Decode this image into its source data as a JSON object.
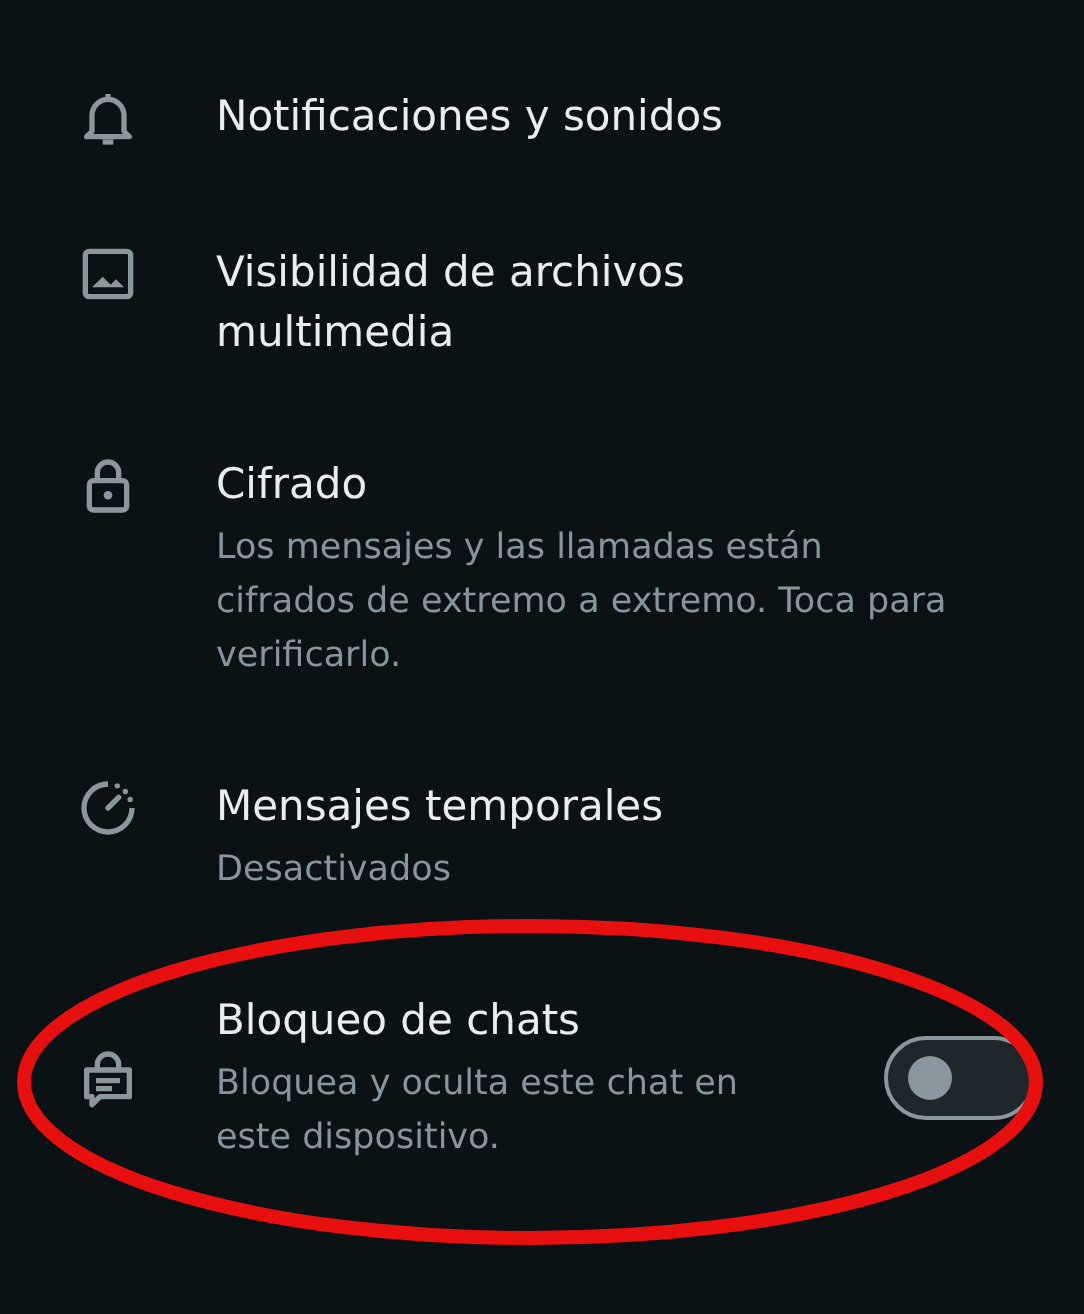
{
  "settings": [
    {
      "title": "Notificaciones y sonidos"
    },
    {
      "title": "Visibilidad de archivos multimedia"
    },
    {
      "title": "Cifrado",
      "subtitle": "Los mensajes y las llamadas están cifrados de extremo a extremo. Toca para verificarlo."
    },
    {
      "title": "Mensajes temporales",
      "subtitle": "Desactivados"
    },
    {
      "title": "Bloqueo de chats",
      "subtitle": "Bloquea y oculta este chat en este dispositivo.",
      "checked": false
    }
  ]
}
